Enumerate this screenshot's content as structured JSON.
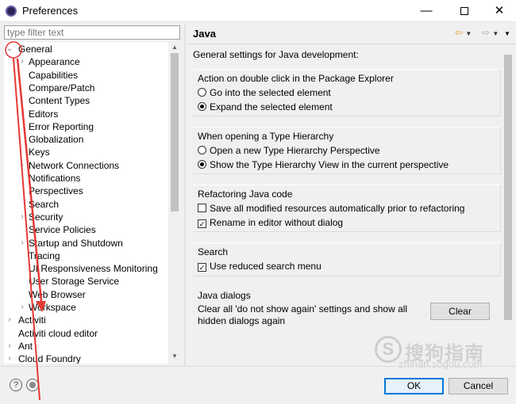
{
  "window": {
    "title": "Preferences",
    "min_glyph": "—",
    "close_glyph": "✕"
  },
  "filter": {
    "placeholder": "type filter text",
    "value": ""
  },
  "tree": [
    {
      "label": "General",
      "expanded": true,
      "level": 0
    },
    {
      "label": "Appearance",
      "level": 1,
      "arrow": true
    },
    {
      "label": "Capabilities",
      "level": 1
    },
    {
      "label": "Compare/Patch",
      "level": 1
    },
    {
      "label": "Content Types",
      "level": 1
    },
    {
      "label": "Editors",
      "level": 1,
      "arrow": true
    },
    {
      "label": "Error Reporting",
      "level": 1
    },
    {
      "label": "Globalization",
      "level": 1
    },
    {
      "label": "Keys",
      "level": 1
    },
    {
      "label": "Network Connections",
      "level": 1,
      "arrow": true
    },
    {
      "label": "Notifications",
      "level": 1
    },
    {
      "label": "Perspectives",
      "level": 1
    },
    {
      "label": "Search",
      "level": 1
    },
    {
      "label": "Security",
      "level": 1,
      "arrow": true
    },
    {
      "label": "Service Policies",
      "level": 1
    },
    {
      "label": "Startup and Shutdown",
      "level": 1,
      "arrow": true
    },
    {
      "label": "Tracing",
      "level": 1
    },
    {
      "label": "UI Responsiveness Monitoring",
      "level": 1
    },
    {
      "label": "User Storage Service",
      "level": 1
    },
    {
      "label": "Web Browser",
      "level": 1
    },
    {
      "label": "Workspace",
      "level": 1,
      "arrow": true
    },
    {
      "label": "Activiti",
      "level": 0,
      "arrow": true
    },
    {
      "label": "Activiti cloud editor",
      "level": 0
    },
    {
      "label": "Ant",
      "level": 0,
      "arrow": true
    },
    {
      "label": "Cloud Foundry",
      "level": 0,
      "arrow": true
    }
  ],
  "page": {
    "title": "Java",
    "description": "General settings for Java development:",
    "groups": {
      "double_click": {
        "title": "Action on double click in the Package Explorer",
        "opt1": "Go into the selected element",
        "opt2": "Expand the selected element"
      },
      "hierarchy": {
        "title": "When opening a Type Hierarchy",
        "opt1": "Open a new Type Hierarchy Perspective",
        "opt2": "Show the Type Hierarchy View in the current perspective"
      },
      "refactoring": {
        "title": "Refactoring Java code",
        "opt1": "Save all modified resources automatically prior to refactoring",
        "opt2": "Rename in editor without dialog"
      },
      "search": {
        "title": "Search",
        "opt1": "Use reduced search menu"
      },
      "dialogs": {
        "title": "Java dialogs",
        "text": "Clear all 'do not show again' settings and show all hidden dialogs again",
        "clear": "Clear"
      }
    }
  },
  "footer": {
    "help_glyph": "?",
    "ok": "OK",
    "cancel": "Cancel"
  },
  "watermark": {
    "symbol": "S",
    "text": "搜狗指南",
    "url": "zhinan.sogou.com"
  }
}
